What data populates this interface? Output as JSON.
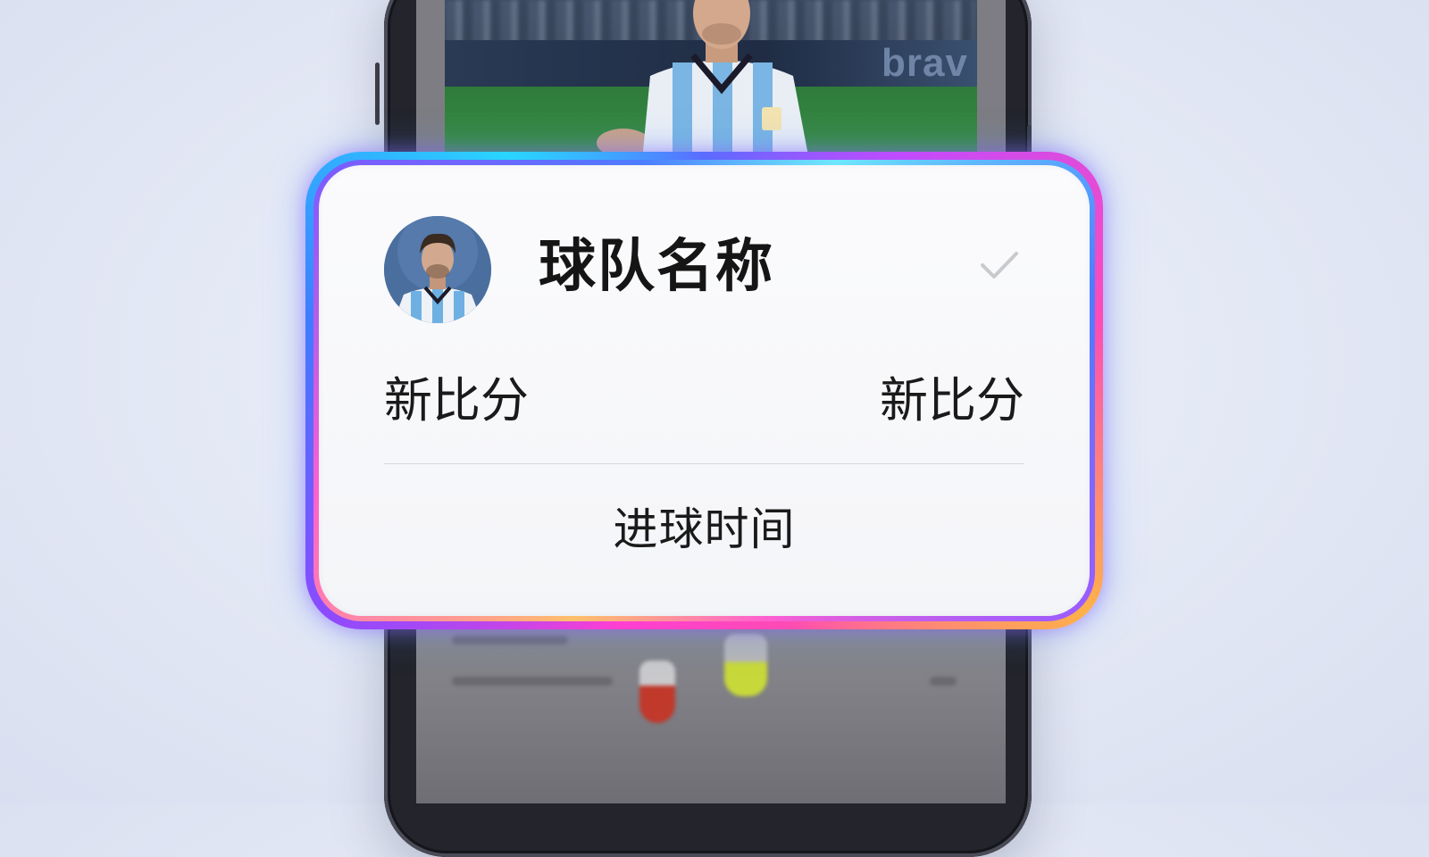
{
  "background": {
    "color": "#e4e9f5"
  },
  "phone": {
    "frame_color": "#23242c",
    "hero_image": {
      "subject": "soccer player in light-blue and white striped jersey"
    },
    "board_text": "brav"
  },
  "card": {
    "avatar": {
      "subject": "player portrait in striped jersey"
    },
    "team_name": "球队名称",
    "check_icon": "check-icon",
    "score_left": "新比分",
    "score_right": "新比分",
    "goal_time": "进球时间"
  },
  "colors": {
    "glow_magenta": "#ff3fd2",
    "glow_blue": "#3f7bff",
    "glow_cyan": "#28d6ff",
    "glow_orange": "#ffb14a",
    "card_bg": "#fbfbfd",
    "text": "#151515"
  }
}
